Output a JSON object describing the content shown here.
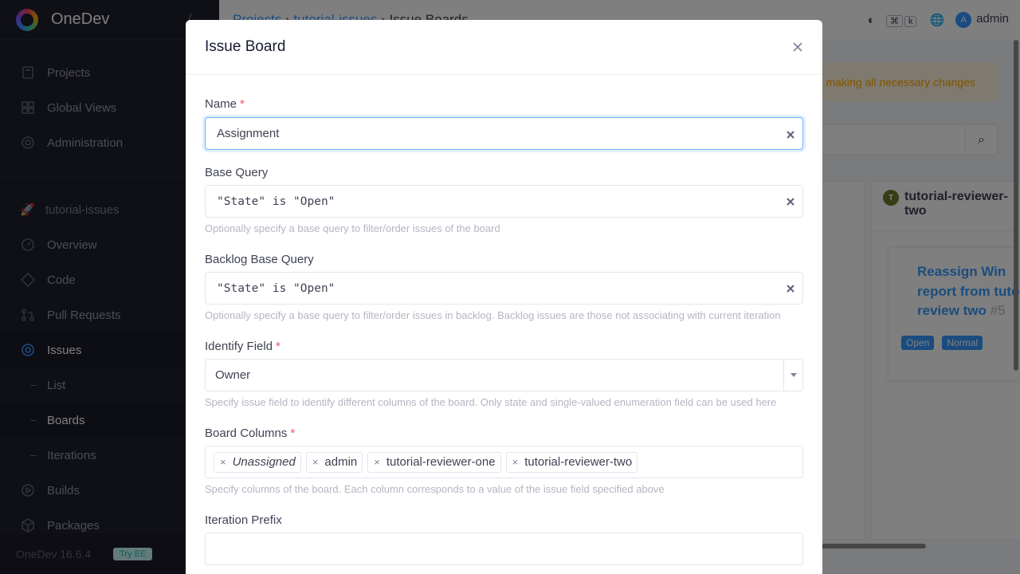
{
  "app": {
    "name": "OneDev",
    "version": "OneDev 16.6.4",
    "ee_badge": "Try EE"
  },
  "sidebar": {
    "global_items": [
      {
        "label": "Projects",
        "icon": "projects-icon"
      },
      {
        "label": "Global Views",
        "icon": "grid-icon"
      },
      {
        "label": "Administration",
        "icon": "gear-icon"
      }
    ],
    "project": "tutorial-issues",
    "project_items": [
      {
        "label": "Overview",
        "icon": "gauge-icon"
      },
      {
        "label": "Code",
        "icon": "code-icon"
      },
      {
        "label": "Pull Requests",
        "icon": "pull-request-icon"
      },
      {
        "label": "Issues",
        "icon": "issues-icon"
      }
    ],
    "issue_sub_items": [
      {
        "label": "List"
      },
      {
        "label": "Boards"
      },
      {
        "label": "Iterations"
      }
    ],
    "more_items": [
      {
        "label": "Builds",
        "icon": "play-icon"
      },
      {
        "label": "Packages",
        "icon": "package-icon"
      }
    ]
  },
  "topbar": {
    "crumb_projects": "Projects",
    "crumb_project": "tutorial-issues",
    "crumb_page": "Issue Boards",
    "kbd_cmd": "⌘",
    "kbd_k": "k",
    "user_initial": "A",
    "user": "admin"
  },
  "background": {
    "alert_text": "making all necessary changes",
    "column_title": "tutorial-reviewer-two",
    "column_avatar": "T",
    "card_title": "Reassign Win report from tutorial-review two",
    "card_number": "#5",
    "card_labels": [
      "Open",
      "Normal"
    ]
  },
  "modal": {
    "title": "Issue Board",
    "name": {
      "label": "Name",
      "value": "Assignment"
    },
    "base_query": {
      "label": "Base Query",
      "value": "\"State\" is \"Open\"",
      "help": "Optionally specify a base query to filter/order issues of the board"
    },
    "backlog_query": {
      "label": "Backlog Base Query",
      "value": "\"State\" is \"Open\"",
      "help": "Optionally specify a base query to filter/order issues in backlog. Backlog issues are those not associating with current iteration"
    },
    "identify_field": {
      "label": "Identify Field",
      "value": "Owner",
      "help": "Specify issue field to identify different columns of the board. Only state and single-valued enumeration field can be used here"
    },
    "board_columns": {
      "label": "Board Columns",
      "values": [
        "Unassigned",
        "admin",
        "tutorial-reviewer-one",
        "tutorial-reviewer-two"
      ],
      "help": "Specify columns of the board. Each column corresponds to a value of the issue field specified above"
    },
    "iteration_prefix": {
      "label": "Iteration Prefix",
      "value": ""
    }
  },
  "colors": {
    "accent": "#3699ff",
    "required": "#f64e60",
    "sidebar_bg": "#1e1e2d",
    "alert_bg": "#fff4de"
  }
}
